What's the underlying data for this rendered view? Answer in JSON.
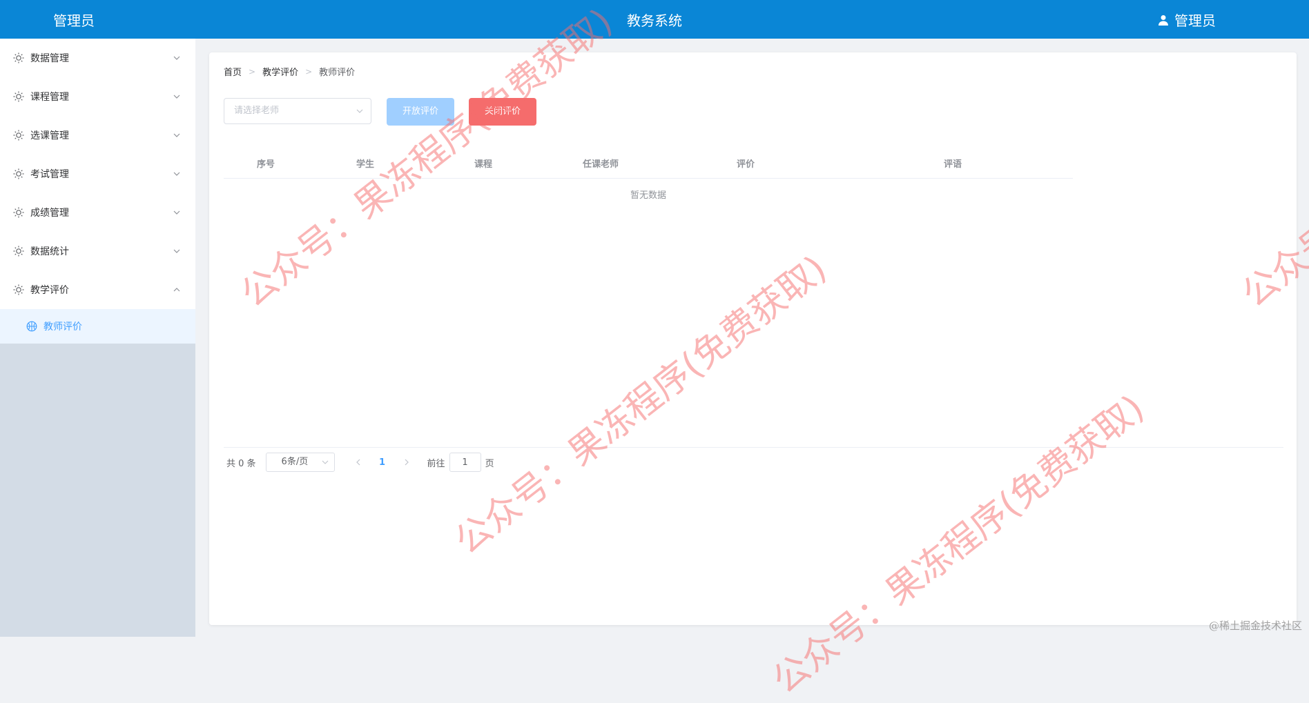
{
  "header": {
    "brand": "管理员",
    "title": "教务系统",
    "user": "管理员"
  },
  "sidebar": {
    "items": [
      {
        "label": "数据管理"
      },
      {
        "label": "课程管理"
      },
      {
        "label": "选课管理"
      },
      {
        "label": "考试管理"
      },
      {
        "label": "成绩管理"
      },
      {
        "label": "数据统计"
      },
      {
        "label": "教学评价"
      }
    ],
    "active_sub": "教师评价"
  },
  "breadcrumb": [
    "首页",
    "教学评价",
    "教师评价"
  ],
  "toolbar": {
    "teacher_placeholder": "请选择老师",
    "open_label": "开放评价",
    "close_label": "关闭评价",
    "open_color": "#a0cfff",
    "close_color": "#f56c6c"
  },
  "table": {
    "columns": [
      "序号",
      "学生",
      "课程",
      "任课老师",
      "评价",
      "评语"
    ],
    "empty_text": "暂无数据"
  },
  "pagination": {
    "total_text": "共 0 条",
    "page_size": "6条/页",
    "current_page": "1",
    "goto_prefix": "前往",
    "goto_value": "1",
    "goto_suffix": "页"
  },
  "watermark": "公众号：果冻程序(免费获取)",
  "corner_mark": "@稀土掘金技术社区",
  "colors": {
    "header_bg": "#0a86d6",
    "accent": "#409eff"
  }
}
